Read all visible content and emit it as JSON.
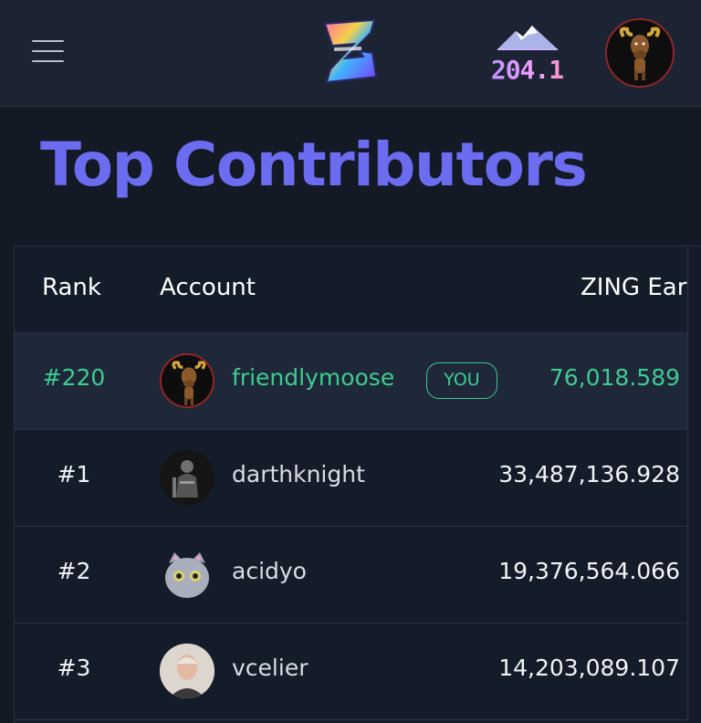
{
  "header": {
    "menu_icon": "hamburger-menu-icon",
    "logo_icon": "zing-z-logo-icon",
    "level_icon": "mountain-icon",
    "level_value": "204.1",
    "avatar_icon": "moose-avatar-icon"
  },
  "page": {
    "title": "Top Contributors"
  },
  "table": {
    "columns": [
      "Rank",
      "Account",
      "ZING Ear"
    ],
    "rows": [
      {
        "rank": "#220",
        "account": "friendlymoose",
        "badge": "YOU",
        "amount": "76,018.589",
        "avatar": "moose-avatar-icon",
        "highlight": true
      },
      {
        "rank": "#1",
        "account": "darthknight",
        "badge": "",
        "amount": "33,487,136.928",
        "avatar": "knight-avatar-icon",
        "highlight": false
      },
      {
        "rank": "#2",
        "account": "acidyo",
        "badge": "",
        "amount": "19,376,564.066",
        "avatar": "cat-avatar-icon",
        "highlight": false
      },
      {
        "rank": "#3",
        "account": "vcelier",
        "badge": "",
        "amount": "14,203,089.107",
        "avatar": "person-avatar-icon",
        "highlight": false
      }
    ]
  },
  "colors": {
    "background": "#131a26",
    "topbar": "#1c2433",
    "title": "#6b6cf0",
    "accent_green": "#3ecb91",
    "highlight_row": "#1e2838"
  }
}
